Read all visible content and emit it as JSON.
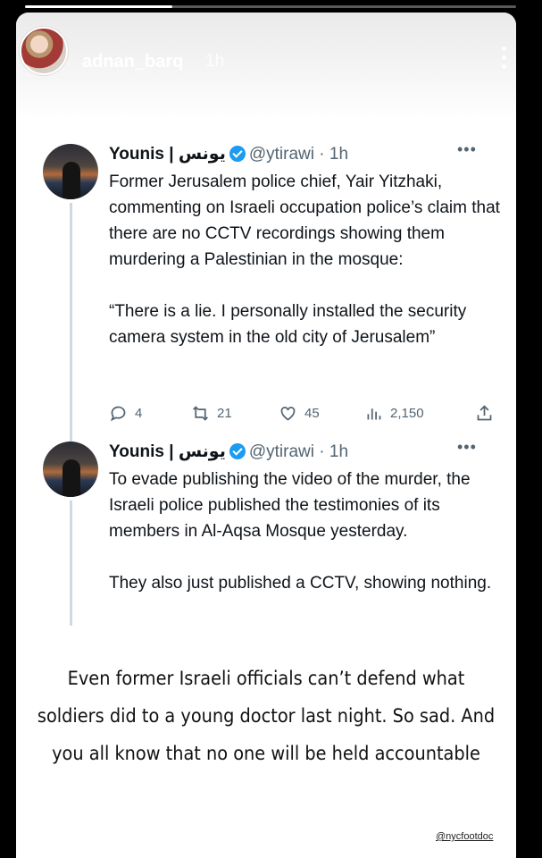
{
  "story": {
    "username": "adnan_barq",
    "time_ago": "1h",
    "caption": "Even former Israeli officials can’t defend what soldiers did to a young doctor last night. So sad. And you all know that no one will be held accountable",
    "credit": "@nycfootdoc"
  },
  "tweets": [
    {
      "name": "Younis | يونس",
      "handle": "@ytirawi",
      "time": "· 1h",
      "more": "•••",
      "paragraphs": [
        "Former Jerusalem police chief, Yair Yitzhaki, commenting on Israeli occupation police’s claim that there are no CCTV recordings showing them murdering a Palestinian in the mosque:",
        "“There is a lie. I personally installed the security camera system in the old city of Jerusalem”"
      ],
      "replies": "4",
      "retweets": "21",
      "likes": "45",
      "views": "2,150"
    },
    {
      "name": "Younis | يونس",
      "handle": "@ytirawi",
      "time": "· 1h",
      "more": "•••",
      "paragraphs": [
        "To evade publishing the video of the murder, the Israeli police published the testimonies of its members in Al-Aqsa Mosque yesterday.",
        "They also just published a CCTV, showing nothing."
      ]
    }
  ],
  "icons": {
    "reply": "reply-icon",
    "retweet": "retweet-icon",
    "like": "like-icon",
    "views": "views-icon",
    "share": "share-icon",
    "verified": "verified-badge-icon"
  },
  "colors": {
    "verified": "#1d9bf0",
    "secondary_text": "#536471",
    "thread_line": "#cfd9de"
  }
}
